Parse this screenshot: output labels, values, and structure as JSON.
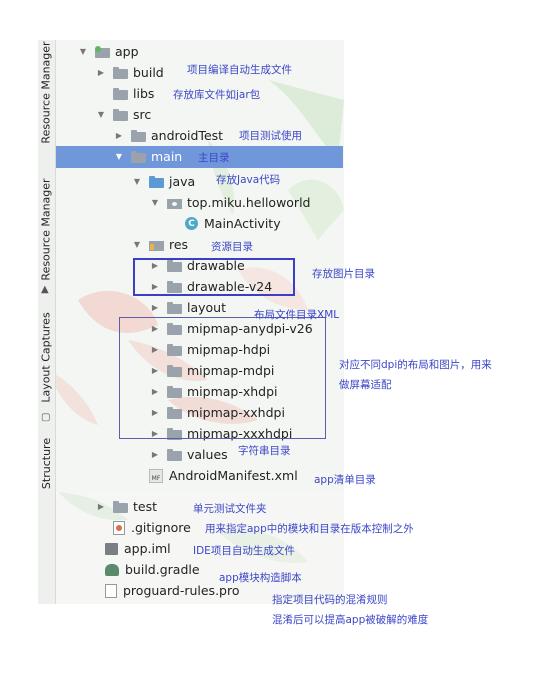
{
  "tool_windows": {
    "resource_manager_top": "Resource Manager",
    "resource_manager": "Resource Manager",
    "layout_captures": "Layout Captures",
    "structure": "Structure"
  },
  "tree": [
    {
      "label": "app",
      "icon": "module-folder-icon",
      "expanded": true
    },
    {
      "label": "build",
      "icon": "folder-icon",
      "expanded": false
    },
    {
      "label": "libs",
      "icon": "folder-icon",
      "expanded": null
    },
    {
      "label": "src",
      "icon": "folder-icon",
      "expanded": true
    },
    {
      "label": "androidTest",
      "icon": "folder-icon",
      "expanded": false
    },
    {
      "label": "main",
      "icon": "folder-icon",
      "expanded": true,
      "selected": true
    },
    {
      "label": "java",
      "icon": "source-folder-icon",
      "expanded": true
    },
    {
      "label": "top.miku.helloworld",
      "icon": "package-icon",
      "expanded": true
    },
    {
      "label": "MainActivity",
      "icon": "class-icon",
      "expanded": null
    },
    {
      "label": "res",
      "icon": "resource-folder-icon",
      "expanded": true
    },
    {
      "label": "drawable",
      "icon": "folder-icon",
      "expanded": false
    },
    {
      "label": "drawable-v24",
      "icon": "folder-icon",
      "expanded": false
    },
    {
      "label": "layout",
      "icon": "folder-icon",
      "expanded": false
    },
    {
      "label": "mipmap-anydpi-v26",
      "icon": "folder-icon",
      "expanded": false
    },
    {
      "label": "mipmap-hdpi",
      "icon": "folder-icon",
      "expanded": false
    },
    {
      "label": "mipmap-mdpi",
      "icon": "folder-icon",
      "expanded": false
    },
    {
      "label": "mipmap-xhdpi",
      "icon": "folder-icon",
      "expanded": false
    },
    {
      "label": "mipmap-xxhdpi",
      "icon": "folder-icon",
      "expanded": false
    },
    {
      "label": "mipmap-xxxhdpi",
      "icon": "folder-icon",
      "expanded": false
    },
    {
      "label": "values",
      "icon": "folder-icon",
      "expanded": false
    },
    {
      "label": "AndroidManifest.xml",
      "icon": "manifest-icon",
      "expanded": null
    },
    {
      "label": "test",
      "icon": "folder-icon",
      "expanded": false
    },
    {
      "label": ".gitignore",
      "icon": "gitignore-file-icon",
      "expanded": null
    },
    {
      "label": "app.iml",
      "icon": "iml-file-icon",
      "expanded": null
    },
    {
      "label": "build.gradle",
      "icon": "gradle-icon",
      "expanded": null
    },
    {
      "label": "proguard-rules.pro",
      "icon": "file-icon",
      "expanded": null
    }
  ],
  "annotations": {
    "build": "项目编译自动生成文件",
    "libs": "存放库文件如jar包",
    "android_test": "项目测试使用",
    "main": "主目录",
    "java": "存放Java代码",
    "res": "资源目录",
    "drawable": "存放图片目录",
    "layout": "布局文件目录XML",
    "mipmap_line1": "对应不同dpi的布局和图片，用来",
    "mipmap_line2": "做屏幕适配",
    "values": "字符串目录",
    "manifest": "app清单目录",
    "test": "单元测试文件夹",
    "gitignore": "用来指定app中的模块和目录在版本控制之外",
    "iml": "IDE项目自动生成文件",
    "gradle": "app模块构造脚本",
    "proguard_line1": "指定项目代码的混淆规则",
    "proguard_line2": "混淆后可以提高app被破解的难度"
  },
  "colors": {
    "selection": "#6f97d9",
    "annotation_text": "#3c46c8",
    "drawable_box": "#3a3fc4",
    "mipmap_box": "#5a5fa8"
  }
}
